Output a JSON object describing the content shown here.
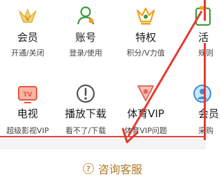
{
  "colors": {
    "annotation_red": "#e23a2f",
    "vip_gold": "#e6b23a",
    "green": "#3c9a3e",
    "orange": "#f0a21e",
    "tv_red": "#e7553f",
    "sport_red": "#e06b5f",
    "blue": "#3a8fd6",
    "cs_gold": "#b07a2a"
  },
  "grid": {
    "row1": [
      {
        "title": "会员",
        "sub": "开通/关闭",
        "icon": "vip-crown-icon"
      },
      {
        "title": "账号",
        "sub": "登录/使用",
        "icon": "account-user-icon"
      },
      {
        "title": "特权",
        "sub": "积分/V力值",
        "icon": "privilege-crown-icon"
      },
      {
        "title": "活",
        "sub": "规则",
        "icon": "activity-icon"
      }
    ],
    "row2": [
      {
        "title": "电视",
        "sub": "超级影视VIP",
        "icon": "tv-icon"
      },
      {
        "title": "播放下载",
        "sub": "看不了/下载",
        "icon": "alert-circle-icon"
      },
      {
        "title": "体育VIP",
        "sub": "体育VIP问题",
        "icon": "sport-vip-icon"
      },
      {
        "title": "会员",
        "sub": "采购",
        "icon": "member-purchase-icon"
      }
    ]
  },
  "footer": {
    "cs_icon": "help-circle-icon",
    "cs_label": "咨询客服"
  }
}
